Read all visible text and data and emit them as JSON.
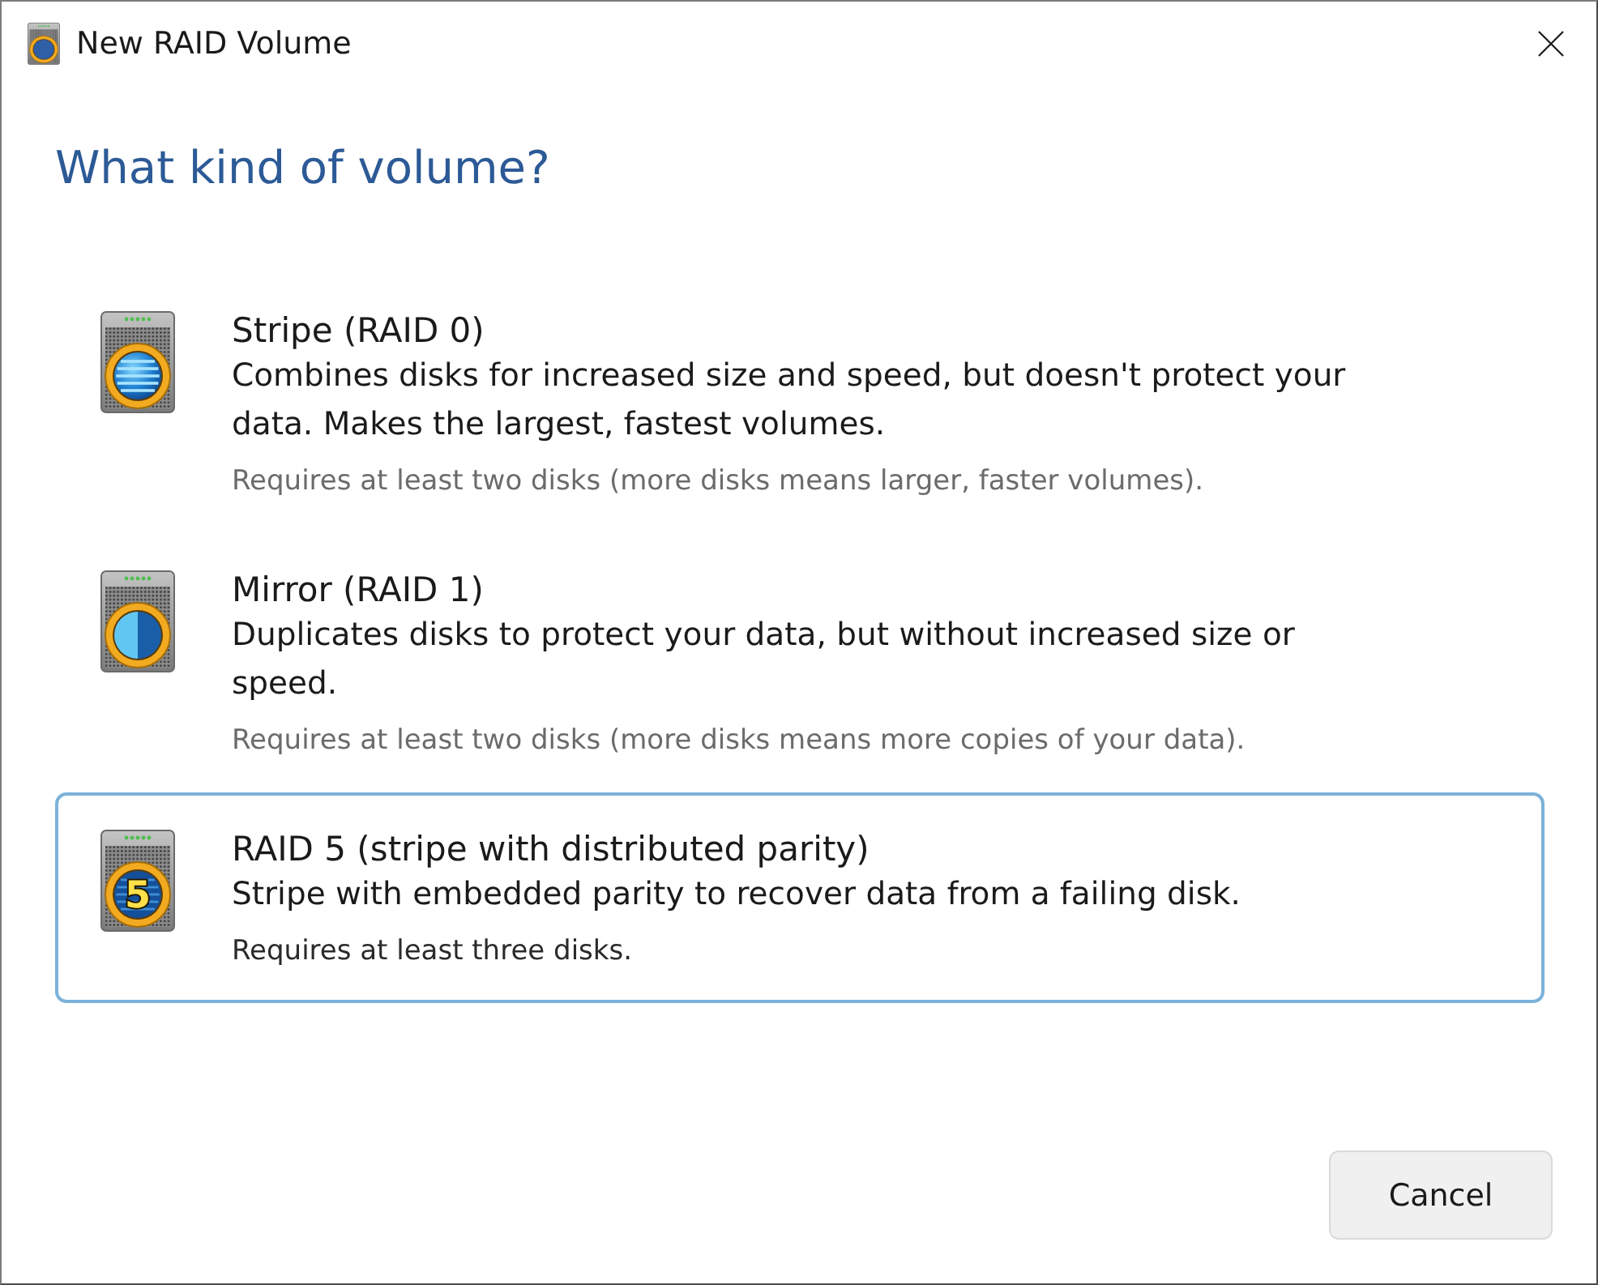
{
  "window": {
    "title": "New RAID Volume"
  },
  "heading": "What kind of volume?",
  "options": [
    {
      "kind": "stripe",
      "title": "Stripe (RAID 0)",
      "description": "Combines disks for increased size and speed, but doesn't protect your data. Makes the largest, fastest volumes.",
      "requirement": "Requires at least two disks (more disks means larger, faster volumes).",
      "selected": false
    },
    {
      "kind": "mirror",
      "title": "Mirror (RAID 1)",
      "description": "Duplicates disks to protect your data, but without increased size or speed.",
      "requirement": "Requires at least two disks (more disks means more copies of your data).",
      "selected": false
    },
    {
      "kind": "parity",
      "title": "RAID 5 (stripe with distributed parity)",
      "description": "Stripe with embedded parity to recover data from a failing disk.",
      "requirement": "Requires at least three disks.",
      "selected": true,
      "icon_label": "5"
    }
  ],
  "buttons": [
    {
      "label": "Cancel"
    }
  ]
}
